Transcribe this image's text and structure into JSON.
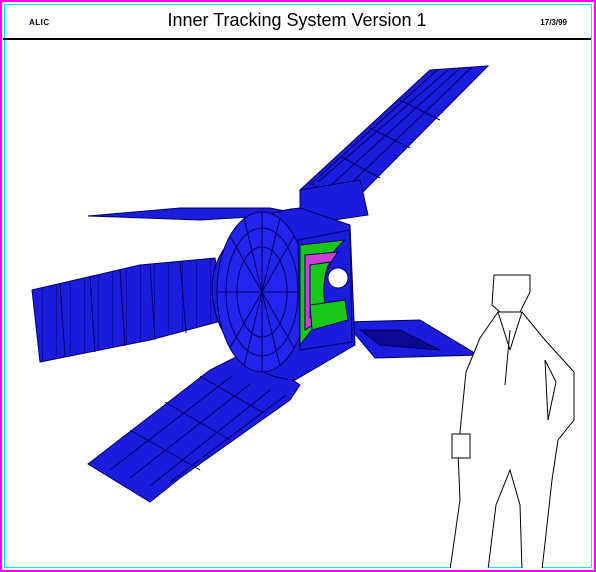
{
  "header": {
    "left_label": "ALIC",
    "title": "Inner Tracking System Version 1",
    "date": "17/3/99"
  },
  "colors": {
    "frame_outer": "#ff00ff",
    "frame_inner": "#00e8ff",
    "detector_blue": "#1c1cdc",
    "detector_edge": "#000060",
    "inner_green": "#18c818",
    "inner_magenta": "#d040d0"
  },
  "scene": {
    "subject": "ITS detector wireframe render",
    "human_figure": "scale-figure-outline"
  }
}
